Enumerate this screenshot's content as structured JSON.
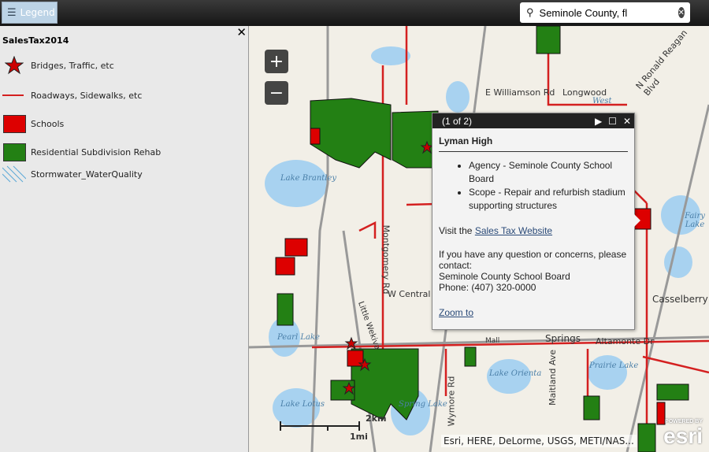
{
  "toolbar": {
    "legend_label": "Legend",
    "search_value": "Seminole County, fl",
    "clear_icon": "close-icon",
    "search_icon": "search-icon"
  },
  "legend": {
    "layer_title": "SalesTax2014",
    "close": "✕",
    "items": [
      {
        "label": "Bridges, Traffic, etc",
        "symbol": "star",
        "color": "#cc0000"
      },
      {
        "label": "Roadways, Sidewalks, etc",
        "symbol": "line",
        "color": "#d42020"
      },
      {
        "label": "Schools",
        "symbol": "fill",
        "color": "#dd0000"
      },
      {
        "label": "Residential Subdivision Rehab",
        "symbol": "fill",
        "color": "#238014"
      },
      {
        "label": "Stormwater_WaterQuality",
        "symbol": "hatch",
        "color": "#5aa8d6"
      }
    ]
  },
  "map": {
    "zoom_in": "+",
    "zoom_out": "−",
    "labels": {
      "lake_brantley": "Lake Brantley",
      "pearl_lake": "Pearl Lake",
      "lake_lotus": "Lake Lotus",
      "spring_lake": "Spring Lake",
      "lake_orienta": "Lake Orienta",
      "prairie_lake": "Prairie Lake",
      "fairy_lake": "Fairy Lake",
      "west": "West",
      "williamson": "E Williamson Rd",
      "longwood": "Longwood",
      "reagan": "N Ronald Reagan Blvd",
      "montgomery": "Montgomery Rd",
      "central": "W Central",
      "wekiva": "Little Wekiva",
      "wymore": "Wymore Rd",
      "maitland": "Maitland Ave",
      "springs": "Springs",
      "altamonte": "Altamonte Dr",
      "casselberry": "Casselberry",
      "mall": "Mall"
    },
    "scale": {
      "km": "2km",
      "mi": "1mi"
    },
    "attribution": "Esri, HERE, DeLorme, USGS, METI/NAS...",
    "logo": "esri",
    "logo_caption": "POWERED BY"
  },
  "popup": {
    "counter": "(1 of 2)",
    "title": "Lyman High",
    "bullets": [
      "Agency - Seminole County School Board",
      "Scope - Repair and refurbish stadium supporting structures"
    ],
    "visit_prefix": "Visit the ",
    "link": "Sales Tax Website",
    "contact_lines": [
      "If you have any question or concerns, please contact:",
      "Seminole County School Board",
      "Phone:  (407) 320-0000"
    ],
    "zoom_to": "Zoom to"
  },
  "colors": {
    "school": "#dd0000",
    "residential": "#238014",
    "road": "#d42020",
    "water": "#a8d2f0"
  }
}
